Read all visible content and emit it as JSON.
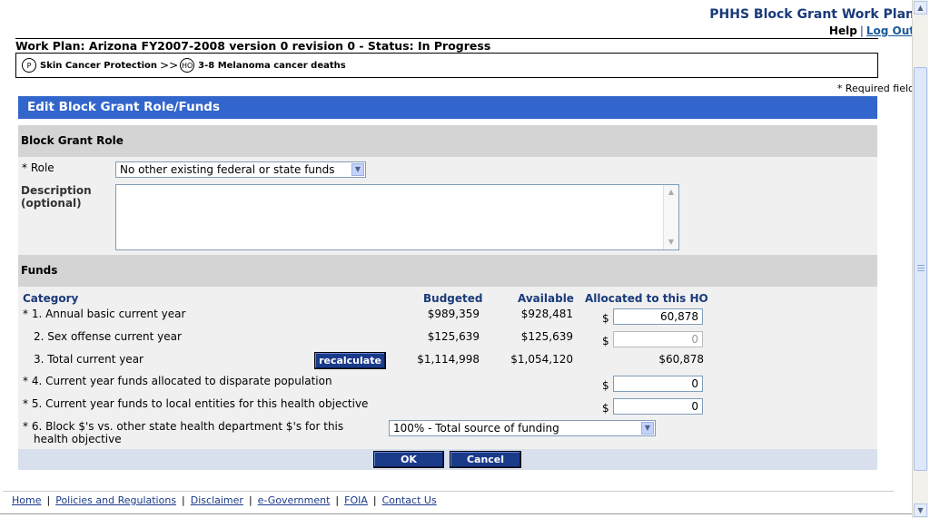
{
  "app": {
    "title": "PHHS Block Grant Work Plan",
    "help": "Help",
    "separator": "|",
    "logout": "Log Out"
  },
  "workplan": {
    "title": "Work Plan: Arizona FY2007-2008 version 0 revision 0 - Status: In Progress"
  },
  "breadcrumb": {
    "program_icon": "P",
    "program": "Skin Cancer Protection",
    "arrow": ">>",
    "objective_icon": "HO",
    "objective": "3-8 Melanoma cancer deaths"
  },
  "required_note": "* Required field",
  "section_title": "Edit Block Grant Role/Funds",
  "role_section": {
    "header": "Block Grant Role",
    "role_label": "* Role",
    "role_value": "No other existing federal or state funds",
    "description_label_1": "Description",
    "description_label_2": "(optional)",
    "description_value": ""
  },
  "funds_section": {
    "header": "Funds",
    "columns": {
      "category": "Category",
      "budgeted": "Budgeted",
      "available": "Available",
      "allocated": "Allocated to this HO"
    },
    "rows": [
      {
        "label": "* 1. Annual basic current year",
        "budgeted": "$989,359",
        "available": "$928,481",
        "currency": "$",
        "allocated": "60,878"
      },
      {
        "label": "2. Sex offense current year",
        "budgeted": "$125,639",
        "available": "$125,639",
        "currency": "$",
        "allocated": "0"
      },
      {
        "label": "3. Total current year",
        "budgeted": "$1,114,998",
        "available": "$1,054,120",
        "allocated": "$60,878"
      },
      {
        "label": "* 4. Current year funds allocated to disparate population",
        "currency": "$",
        "allocated": "0"
      },
      {
        "label": "* 5. Current year funds to local entities for this health objective",
        "currency": "$",
        "allocated": "0"
      },
      {
        "label_line1": "* 6. Block $'s vs. other state health department $'s for this",
        "label_line2": "health objective",
        "select_value": "100% - Total source of funding"
      }
    ],
    "recalculate": "recalculate"
  },
  "buttons": {
    "ok": "OK",
    "cancel": "Cancel"
  },
  "footer": {
    "links": [
      "Home",
      "Policies and Regulations",
      "Disclaimer",
      "e-Government",
      "FOIA",
      "Contact Us"
    ],
    "separator": "|"
  },
  "icons": {
    "dropdown": "chevron-down-icon",
    "scroll_up": "arrow-up-icon",
    "scroll_down": "arrow-down-icon"
  },
  "colors": {
    "header_bar": "#3366cc",
    "title_blue": "#1a3a7a",
    "button": "#1a3a8a",
    "subhead_gray": "#d4d4d4"
  }
}
